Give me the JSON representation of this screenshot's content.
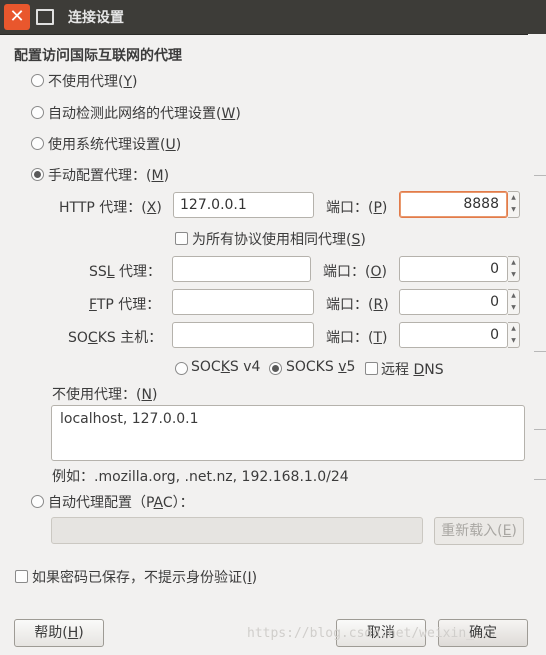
{
  "window": {
    "title": "连接设置"
  },
  "section_title": "配置访问国际互联网的代理",
  "modes": {
    "no_proxy": {
      "text": "不使用代理(",
      "key": "Y",
      "end": ")"
    },
    "auto_detect": {
      "text": "自动检测此网络的代理设置(",
      "key": "W",
      "end": ")"
    },
    "system": {
      "text": "使用系统代理设置(",
      "key": "U",
      "end": ")"
    },
    "manual": {
      "text": "手动配置代理：(",
      "key": "M",
      "end": ")",
      "selected": true
    }
  },
  "http": {
    "label": "HTTP 代理：(",
    "key": "X",
    "end": ")",
    "value": "127.0.0.1",
    "port_label": "端口：(",
    "port_key": "P",
    "port_end": ")",
    "port": "8888"
  },
  "same_proxy": {
    "text": "为所有协议使用相同代理(",
    "key": "S",
    "end": ")"
  },
  "ssl": {
    "label_pre": "SS",
    "key": "L",
    "label_post": " 代理：",
    "value": "",
    "port_label": "端口：(",
    "port_key": "O",
    "port_end": ")",
    "port": "0"
  },
  "ftp": {
    "key": "F",
    "label_post": "TP 代理：",
    "value": "",
    "port_label": "端口：(",
    "port_key": "R",
    "port_end": ")",
    "port": "0"
  },
  "socks": {
    "label_pre": "SO",
    "key": "C",
    "label_post": "KS 主机：",
    "value": "",
    "port_label": "端口：(",
    "port_key": "T",
    "port_end": ")",
    "port": "0"
  },
  "socks_version": {
    "v4": {
      "pre": "SOC",
      "key": "K",
      "post": "S v4"
    },
    "v5": {
      "pre": "SOCKS ",
      "key": "v",
      "post": "5",
      "selected": true
    },
    "remote_dns": {
      "pre": "远程 ",
      "key": "D",
      "post": "NS"
    }
  },
  "no_proxy_for": {
    "label": "不使用代理：(",
    "key": "N",
    "end": ")",
    "value": "localhost, 127.0.0.1",
    "example": "例如：.mozilla.org, .net.nz, 192.168.1.0/24"
  },
  "pac": {
    "text": "自动代理配置（P",
    "key": "A",
    "end": "C）：",
    "value": "",
    "reload_pre": "重新载入(",
    "reload_key": "E",
    "reload_end": ")"
  },
  "no_auth": {
    "text": "如果密码已保存，不提示身份验证(",
    "key": "I",
    "end": ")"
  },
  "buttons": {
    "help_pre": "帮助(",
    "help_key": "H",
    "help_end": ")",
    "cancel": "取消",
    "ok": "确定"
  },
  "watermark": "https://blog.csdn.net/weixin_..."
}
